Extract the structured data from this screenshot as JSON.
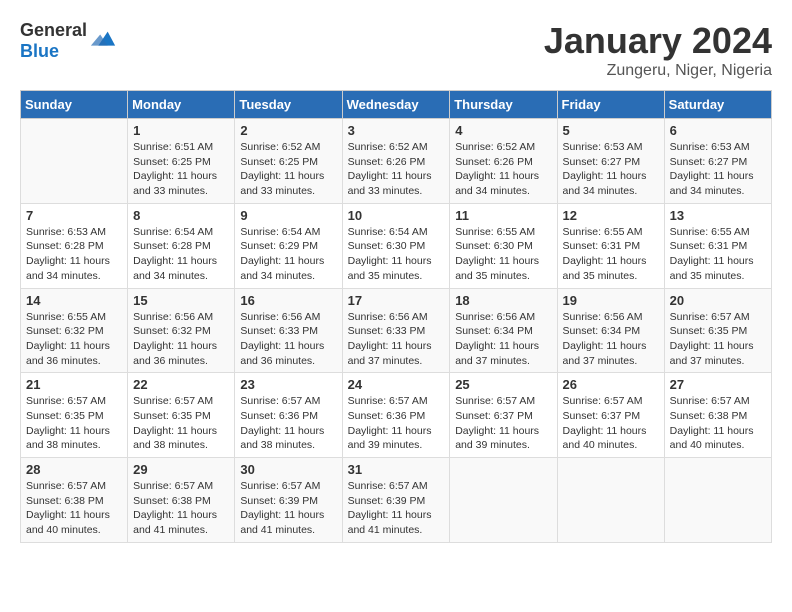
{
  "header": {
    "logo_general": "General",
    "logo_blue": "Blue",
    "month": "January 2024",
    "location": "Zungeru, Niger, Nigeria"
  },
  "days": [
    "Sunday",
    "Monday",
    "Tuesday",
    "Wednesday",
    "Thursday",
    "Friday",
    "Saturday"
  ],
  "weeks": [
    [
      {
        "day": "",
        "sunrise": "",
        "sunset": "",
        "daylight": ""
      },
      {
        "day": "1",
        "sunrise": "Sunrise: 6:51 AM",
        "sunset": "Sunset: 6:25 PM",
        "daylight": "Daylight: 11 hours and 33 minutes."
      },
      {
        "day": "2",
        "sunrise": "Sunrise: 6:52 AM",
        "sunset": "Sunset: 6:25 PM",
        "daylight": "Daylight: 11 hours and 33 minutes."
      },
      {
        "day": "3",
        "sunrise": "Sunrise: 6:52 AM",
        "sunset": "Sunset: 6:26 PM",
        "daylight": "Daylight: 11 hours and 33 minutes."
      },
      {
        "day": "4",
        "sunrise": "Sunrise: 6:52 AM",
        "sunset": "Sunset: 6:26 PM",
        "daylight": "Daylight: 11 hours and 34 minutes."
      },
      {
        "day": "5",
        "sunrise": "Sunrise: 6:53 AM",
        "sunset": "Sunset: 6:27 PM",
        "daylight": "Daylight: 11 hours and 34 minutes."
      },
      {
        "day": "6",
        "sunrise": "Sunrise: 6:53 AM",
        "sunset": "Sunset: 6:27 PM",
        "daylight": "Daylight: 11 hours and 34 minutes."
      }
    ],
    [
      {
        "day": "7",
        "sunrise": "Sunrise: 6:53 AM",
        "sunset": "Sunset: 6:28 PM",
        "daylight": "Daylight: 11 hours and 34 minutes."
      },
      {
        "day": "8",
        "sunrise": "Sunrise: 6:54 AM",
        "sunset": "Sunset: 6:28 PM",
        "daylight": "Daylight: 11 hours and 34 minutes."
      },
      {
        "day": "9",
        "sunrise": "Sunrise: 6:54 AM",
        "sunset": "Sunset: 6:29 PM",
        "daylight": "Daylight: 11 hours and 34 minutes."
      },
      {
        "day": "10",
        "sunrise": "Sunrise: 6:54 AM",
        "sunset": "Sunset: 6:30 PM",
        "daylight": "Daylight: 11 hours and 35 minutes."
      },
      {
        "day": "11",
        "sunrise": "Sunrise: 6:55 AM",
        "sunset": "Sunset: 6:30 PM",
        "daylight": "Daylight: 11 hours and 35 minutes."
      },
      {
        "day": "12",
        "sunrise": "Sunrise: 6:55 AM",
        "sunset": "Sunset: 6:31 PM",
        "daylight": "Daylight: 11 hours and 35 minutes."
      },
      {
        "day": "13",
        "sunrise": "Sunrise: 6:55 AM",
        "sunset": "Sunset: 6:31 PM",
        "daylight": "Daylight: 11 hours and 35 minutes."
      }
    ],
    [
      {
        "day": "14",
        "sunrise": "Sunrise: 6:55 AM",
        "sunset": "Sunset: 6:32 PM",
        "daylight": "Daylight: 11 hours and 36 minutes."
      },
      {
        "day": "15",
        "sunrise": "Sunrise: 6:56 AM",
        "sunset": "Sunset: 6:32 PM",
        "daylight": "Daylight: 11 hours and 36 minutes."
      },
      {
        "day": "16",
        "sunrise": "Sunrise: 6:56 AM",
        "sunset": "Sunset: 6:33 PM",
        "daylight": "Daylight: 11 hours and 36 minutes."
      },
      {
        "day": "17",
        "sunrise": "Sunrise: 6:56 AM",
        "sunset": "Sunset: 6:33 PM",
        "daylight": "Daylight: 11 hours and 37 minutes."
      },
      {
        "day": "18",
        "sunrise": "Sunrise: 6:56 AM",
        "sunset": "Sunset: 6:34 PM",
        "daylight": "Daylight: 11 hours and 37 minutes."
      },
      {
        "day": "19",
        "sunrise": "Sunrise: 6:56 AM",
        "sunset": "Sunset: 6:34 PM",
        "daylight": "Daylight: 11 hours and 37 minutes."
      },
      {
        "day": "20",
        "sunrise": "Sunrise: 6:57 AM",
        "sunset": "Sunset: 6:35 PM",
        "daylight": "Daylight: 11 hours and 37 minutes."
      }
    ],
    [
      {
        "day": "21",
        "sunrise": "Sunrise: 6:57 AM",
        "sunset": "Sunset: 6:35 PM",
        "daylight": "Daylight: 11 hours and 38 minutes."
      },
      {
        "day": "22",
        "sunrise": "Sunrise: 6:57 AM",
        "sunset": "Sunset: 6:35 PM",
        "daylight": "Daylight: 11 hours and 38 minutes."
      },
      {
        "day": "23",
        "sunrise": "Sunrise: 6:57 AM",
        "sunset": "Sunset: 6:36 PM",
        "daylight": "Daylight: 11 hours and 38 minutes."
      },
      {
        "day": "24",
        "sunrise": "Sunrise: 6:57 AM",
        "sunset": "Sunset: 6:36 PM",
        "daylight": "Daylight: 11 hours and 39 minutes."
      },
      {
        "day": "25",
        "sunrise": "Sunrise: 6:57 AM",
        "sunset": "Sunset: 6:37 PM",
        "daylight": "Daylight: 11 hours and 39 minutes."
      },
      {
        "day": "26",
        "sunrise": "Sunrise: 6:57 AM",
        "sunset": "Sunset: 6:37 PM",
        "daylight": "Daylight: 11 hours and 40 minutes."
      },
      {
        "day": "27",
        "sunrise": "Sunrise: 6:57 AM",
        "sunset": "Sunset: 6:38 PM",
        "daylight": "Daylight: 11 hours and 40 minutes."
      }
    ],
    [
      {
        "day": "28",
        "sunrise": "Sunrise: 6:57 AM",
        "sunset": "Sunset: 6:38 PM",
        "daylight": "Daylight: 11 hours and 40 minutes."
      },
      {
        "day": "29",
        "sunrise": "Sunrise: 6:57 AM",
        "sunset": "Sunset: 6:38 PM",
        "daylight": "Daylight: 11 hours and 41 minutes."
      },
      {
        "day": "30",
        "sunrise": "Sunrise: 6:57 AM",
        "sunset": "Sunset: 6:39 PM",
        "daylight": "Daylight: 11 hours and 41 minutes."
      },
      {
        "day": "31",
        "sunrise": "Sunrise: 6:57 AM",
        "sunset": "Sunset: 6:39 PM",
        "daylight": "Daylight: 11 hours and 41 minutes."
      },
      {
        "day": "",
        "sunrise": "",
        "sunset": "",
        "daylight": ""
      },
      {
        "day": "",
        "sunrise": "",
        "sunset": "",
        "daylight": ""
      },
      {
        "day": "",
        "sunrise": "",
        "sunset": "",
        "daylight": ""
      }
    ]
  ]
}
